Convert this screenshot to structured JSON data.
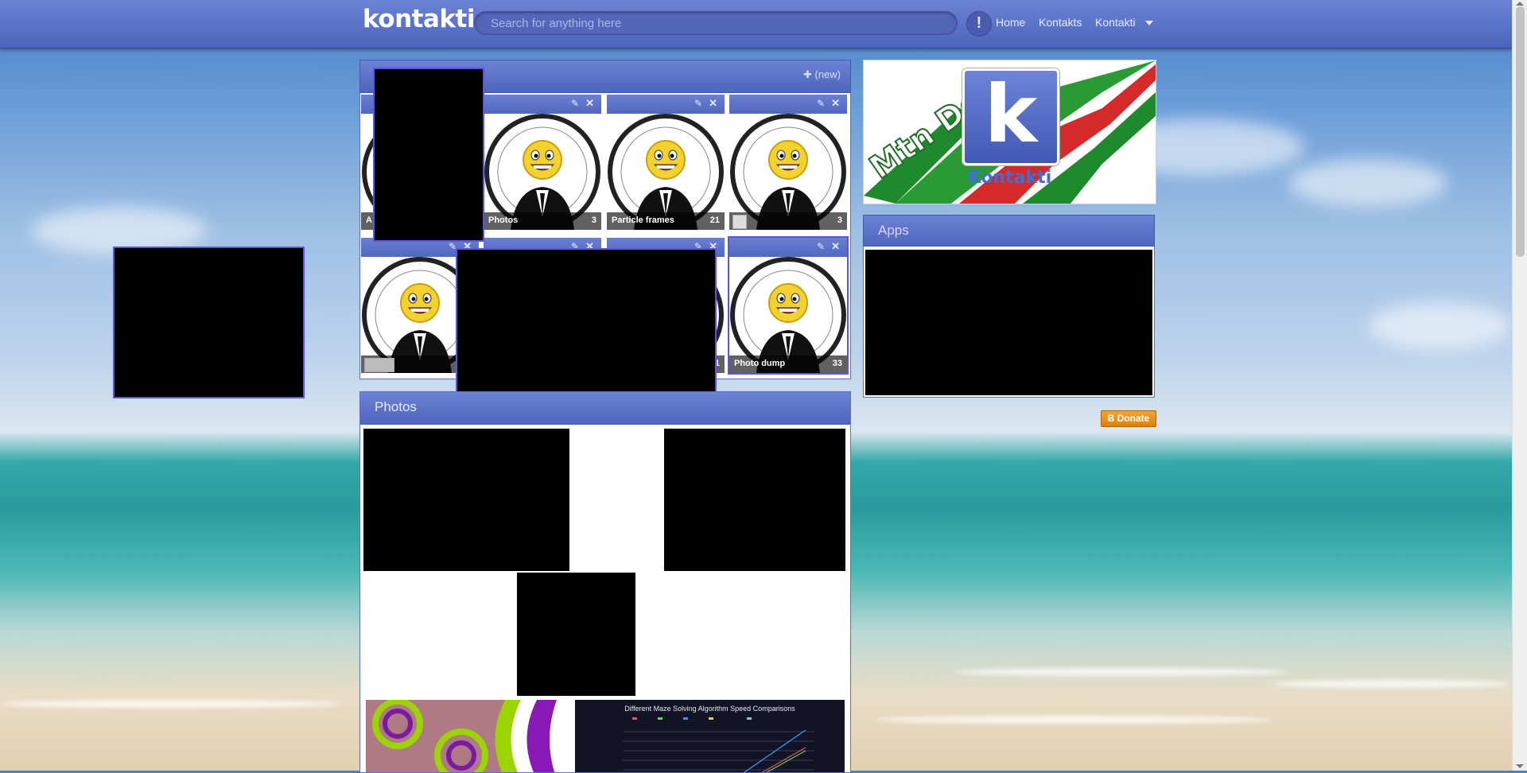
{
  "app": {
    "logo": "kontakti",
    "search_placeholder": "Search for anything here",
    "alert_icon_glyph": "!",
    "nav": [
      "Home",
      "Kontakts",
      "Kontakti"
    ]
  },
  "albums": {
    "new_label": "(new)",
    "items": [
      {
        "name": "A",
        "count": ""
      },
      {
        "name": "Photos",
        "count": "3"
      },
      {
        "name": "Particle frames",
        "count": "21"
      },
      {
        "name": "",
        "count": "3"
      },
      {
        "name": "",
        "count": ""
      },
      {
        "name": "",
        "count": ""
      },
      {
        "name": "",
        "count": "1"
      },
      {
        "name": "Photo dump",
        "count": "33"
      }
    ]
  },
  "photos": {
    "title": "Photos",
    "chart_title": "Different Maze Solving Algorithm Speed Comparisons"
  },
  "sidebar": {
    "profile_caption": "Kontakti",
    "profile_letter": "k",
    "apps_title": "Apps",
    "donate_label": "Donate",
    "donate_glyph": "Ƀ"
  }
}
